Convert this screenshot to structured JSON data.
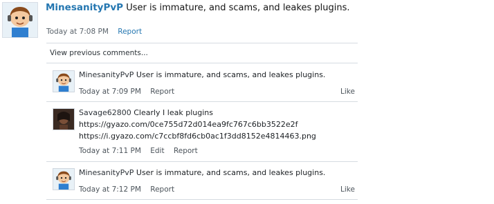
{
  "post": {
    "username": "MinesanityPvP",
    "message": "User is immature, and scams, and leakes plugins.",
    "time": "Today at 7:08 PM",
    "report_label": "Report"
  },
  "view_previous_label": "View previous comments...",
  "comments": [
    {
      "username": "MinesanityPvP",
      "message": "User is immature, and scams, and leakes plugins.",
      "time": "Today at 7:09 PM",
      "report_label": "Report",
      "like_label": "Like"
    },
    {
      "username": "Savage62800",
      "message": "Clearly I leak plugins",
      "links": [
        "https://gyazo.com/0ce755d72d014ea9fc767c6bb3522e2f",
        "https://i.gyazo.com/c7ccbf8fd6cb0ac1f3dd8152e4814463.png"
      ],
      "time": "Today at 7:11 PM",
      "edit_label": "Edit",
      "report_label": "Report"
    },
    {
      "username": "MinesanityPvP",
      "message": "User is immature, and scams, and leakes plugins.",
      "time": "Today at 7:12 PM",
      "report_label": "Report",
      "like_label": "Like"
    }
  ],
  "colors": {
    "username_link": "#2577b1",
    "divider": "#d5dbe1",
    "meta_text": "#6b7680"
  }
}
